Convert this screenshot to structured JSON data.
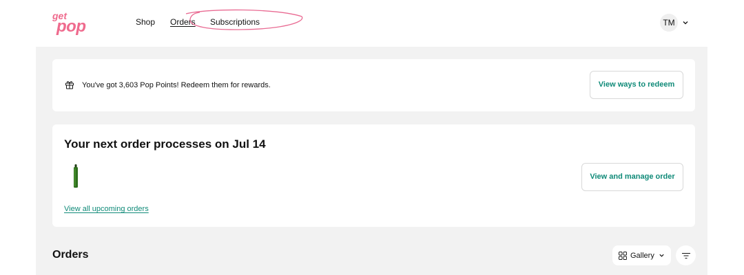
{
  "header": {
    "logo_top": "get",
    "logo_bottom": "pop",
    "nav": {
      "shop": "Shop",
      "orders": "Orders",
      "subscriptions": "Subscriptions"
    },
    "user_initials": "TM"
  },
  "points_banner": {
    "icon": "gift-icon",
    "message": "You've got 3,603 Pop Points! Redeem them for rewards.",
    "button": "View ways to redeem"
  },
  "next_order": {
    "title": "Your next order processes on Jul 14",
    "manage_button": "View and manage order",
    "upcoming_link": "View all upcoming orders"
  },
  "orders": {
    "title": "Orders",
    "view_toggle": "Gallery",
    "filter_icon": "filter-icon"
  },
  "colors": {
    "brand_pink": "#ef6b8e",
    "accent_teal": "#0f8a78",
    "background_gray": "#f2f2f2"
  }
}
